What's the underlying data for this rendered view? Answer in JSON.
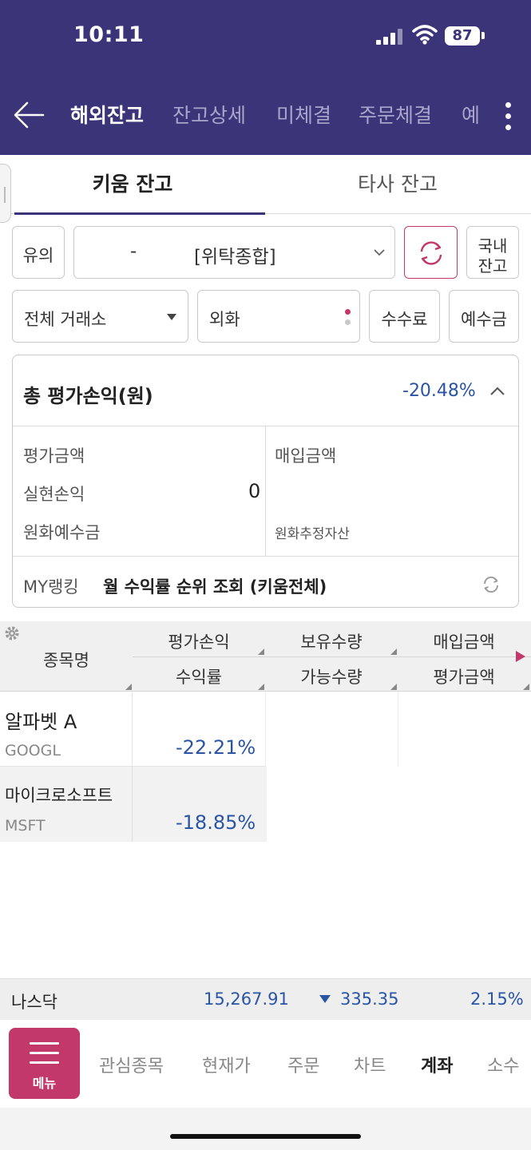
{
  "status_bar": {
    "time": "10:11",
    "battery": "87"
  },
  "header": {
    "tabs": [
      {
        "label": "해외잔고",
        "active": true
      },
      {
        "label": "잔고상세"
      },
      {
        "label": "미체결"
      },
      {
        "label": "주문체결"
      },
      {
        "label": "예"
      }
    ]
  },
  "subtabs": [
    {
      "label": "키움 잔고",
      "active": true
    },
    {
      "label": "타사 잔고"
    }
  ],
  "controls": {
    "notice_button": "유의",
    "account_select": {
      "dash": "-",
      "type": "[위탁종합]"
    },
    "domestic_button": [
      "국내",
      "잔고"
    ],
    "exchange_select": "전체 거래소",
    "currency_select": "외화",
    "fee_button": "수수료",
    "deposit_button": "예수금"
  },
  "summary": {
    "title": "총 평가손익(원)",
    "rate": "-20.48%",
    "eval_amount_label": "평가금액",
    "realized_label": "실현손익",
    "realized_value": "0",
    "krw_deposit_label": "원화예수금",
    "purchase_amount_label": "매입금액",
    "krw_est_assets_label": "원화추정자산",
    "ranking_label": "MY랭킹",
    "ranking_text": "월 수익률 순위 조회 (키움전체)"
  },
  "table": {
    "headers": {
      "name": "종목명",
      "pnl": "평가손익",
      "rate": "수익률",
      "qty": "보유수량",
      "avail_qty": "가능수량",
      "purchase": "매입금액",
      "eval": "평가금액"
    },
    "rows": [
      {
        "name": "알파벳 A",
        "code": "GOOGL",
        "rate": "-22.21%"
      },
      {
        "name": "마이크로소프트",
        "code": "MSFT",
        "rate": "-18.85%"
      }
    ]
  },
  "ticker": {
    "name": "나스닥",
    "value": "15,267.91",
    "change": "335.35",
    "change_pct": "2.15%",
    "direction": "down"
  },
  "bottom_nav": {
    "menu_label": "메뉴",
    "items": [
      {
        "label": "관심종목"
      },
      {
        "label": "현재가"
      },
      {
        "label": "주문"
      },
      {
        "label": "차트"
      },
      {
        "label": "계좌",
        "active": true
      },
      {
        "label": "소수"
      }
    ]
  },
  "colors": {
    "header_bg": "#3b3478",
    "menu_accent": "#c2386b",
    "negative": "#2a55a5"
  }
}
